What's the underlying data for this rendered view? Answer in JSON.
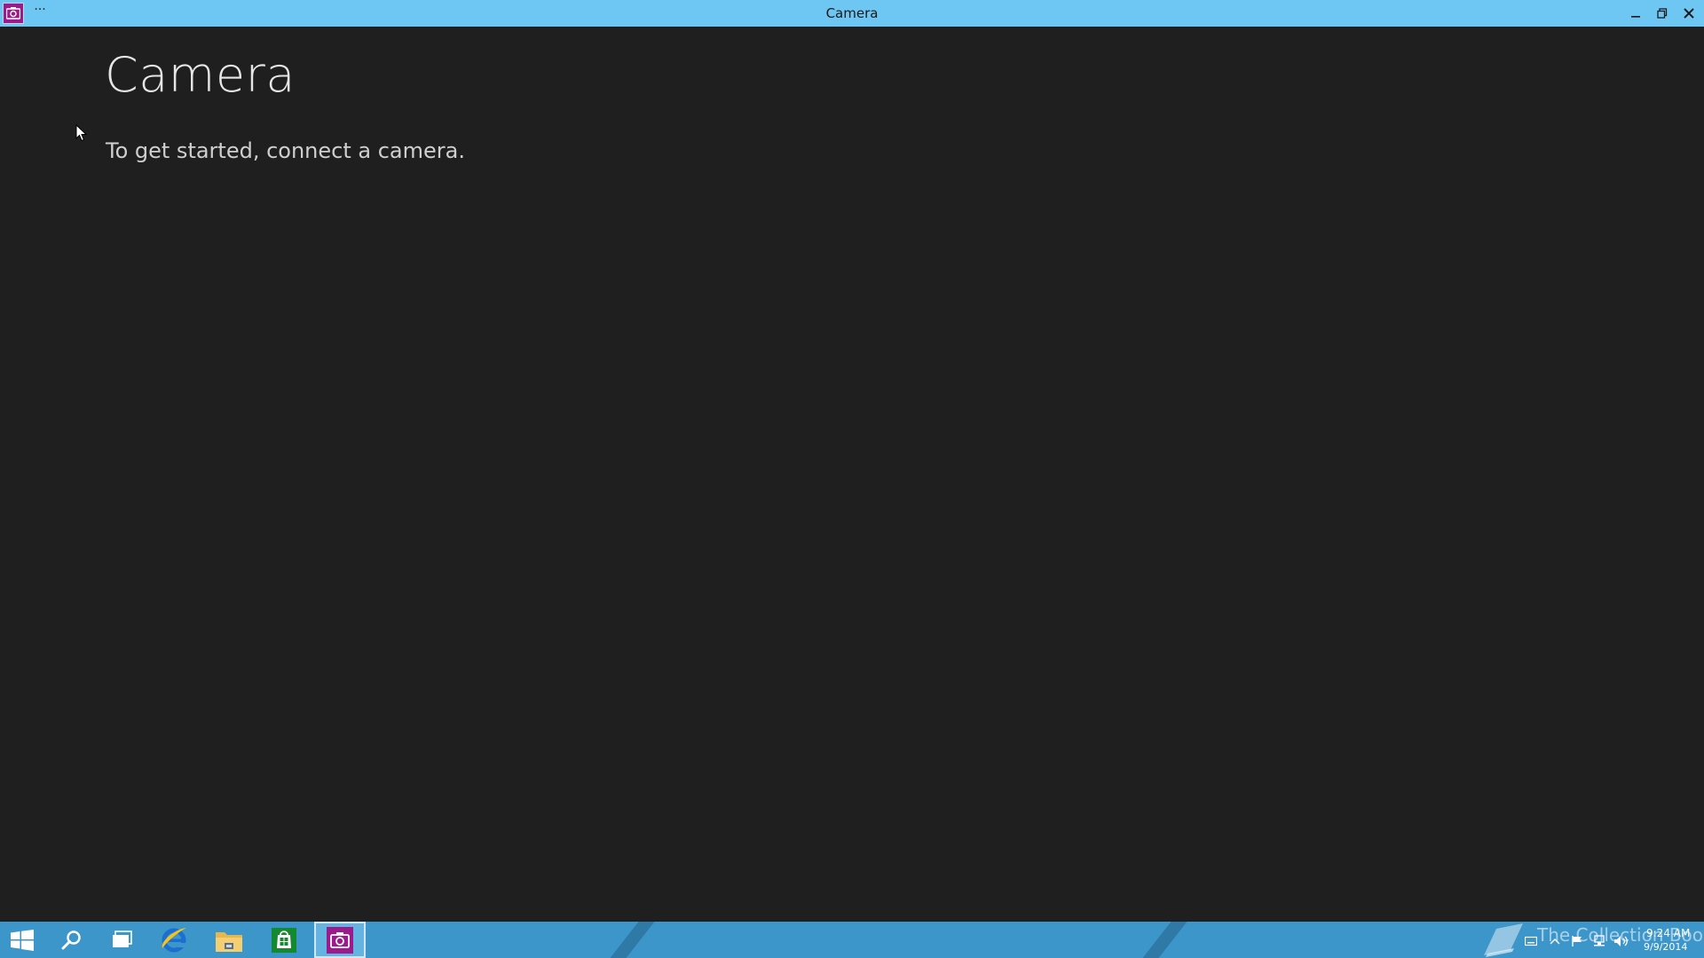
{
  "window": {
    "title": "Camera",
    "menu_glyph": "···"
  },
  "main": {
    "title": "Camera",
    "message": "To get started, connect a camera."
  },
  "taskbar": {
    "items": [
      {
        "name": "start-button",
        "icon": "windows-logo-icon"
      },
      {
        "name": "search-button",
        "icon": "search-icon"
      },
      {
        "name": "task-view-button",
        "icon": "task-view-icon"
      },
      {
        "name": "internet-explorer-button",
        "icon": "internet-explorer-icon"
      },
      {
        "name": "file-explorer-button",
        "icon": "folder-icon"
      },
      {
        "name": "store-button",
        "icon": "store-icon"
      },
      {
        "name": "camera-app-button",
        "icon": "camera-icon",
        "active": true
      }
    ],
    "watermark": "The Collection Book",
    "clock": {
      "time": "9:24 AM",
      "date": "9/9/2014"
    }
  },
  "colors": {
    "titlebar": "#6ec6f2",
    "background": "#1f1f1f",
    "taskbar": "#3d96ca",
    "camera_accent": "#9b1a8c",
    "store_accent": "#138a2f"
  }
}
